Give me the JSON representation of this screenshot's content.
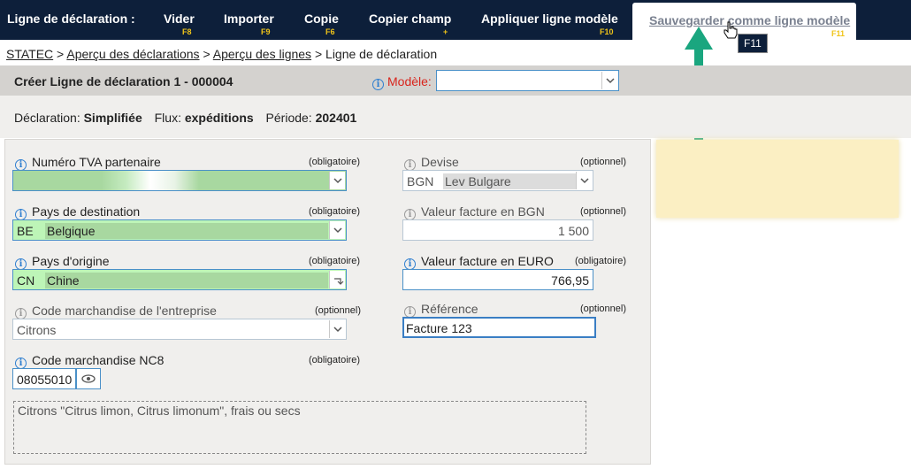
{
  "toolbar": {
    "title": "Ligne de déclaration :",
    "buttons": [
      {
        "label": "Vider",
        "key": "F8"
      },
      {
        "label": "Importer",
        "key": "F9"
      },
      {
        "label": "Copie",
        "key": "F6"
      },
      {
        "label": "Copier champ",
        "key": "+"
      },
      {
        "label": "Appliquer ligne modèle",
        "key": "F10"
      },
      {
        "label": "Sauvegarder comme ligne modèle",
        "key": "F11"
      }
    ],
    "tooltip": "F11"
  },
  "breadcrumb": {
    "items": [
      "STATEC",
      "Aperçu des déclarations",
      "Aperçu des lignes"
    ],
    "separator": ">",
    "current": "Ligne de déclaration"
  },
  "header": {
    "title": "Créer Ligne de déclaration 1 - 000004",
    "modele_label": "Modèle:",
    "modele_value": ""
  },
  "declaration_info": {
    "declaration_label": "Déclaration:",
    "declaration_value": "Simplifiée",
    "flux_label": "Flux:",
    "flux_value": "expéditions",
    "periode_label": "Période:",
    "periode_value": "202401"
  },
  "form": {
    "tva": {
      "label": "Numéro TVA partenaire",
      "req": "(obligatoire)",
      "value": ""
    },
    "pays_dest": {
      "label": "Pays de destination",
      "req": "(obligatoire)",
      "code": "BE",
      "name": "Belgique"
    },
    "pays_orig": {
      "label": "Pays d'origine",
      "req": "(obligatoire)",
      "code": "CN",
      "name": "Chine"
    },
    "code_entreprise": {
      "label": "Code marchandise de l'entreprise",
      "req": "(optionnel)",
      "value": "Citrons"
    },
    "code_nc8": {
      "label": "Code marchandise NC8",
      "req": "(obligatoire)",
      "value": "08055010"
    },
    "devise": {
      "label": "Devise",
      "req": "(optionnel)",
      "code": "BGN",
      "name": "Lev Bulgare"
    },
    "valeur_bgn": {
      "label": "Valeur facture en BGN",
      "req": "(optionnel)",
      "value": "1 500"
    },
    "valeur_euro": {
      "label": "Valeur facture en EURO",
      "req": "(obligatoire)",
      "value": "766,95"
    },
    "reference": {
      "label": "Référence",
      "req": "(optionnel)",
      "value": "Facture 123"
    },
    "description": "Citrons \"Citrus limon, Citrus limonum\", frais ou secs"
  },
  "colors": {
    "toolbar_bg": "#0d1f3a",
    "key_yellow": "#f0c419",
    "required_green": "#a8d8a0",
    "arrow_green": "#1aa67f",
    "note_yellow": "#fbefc3"
  }
}
